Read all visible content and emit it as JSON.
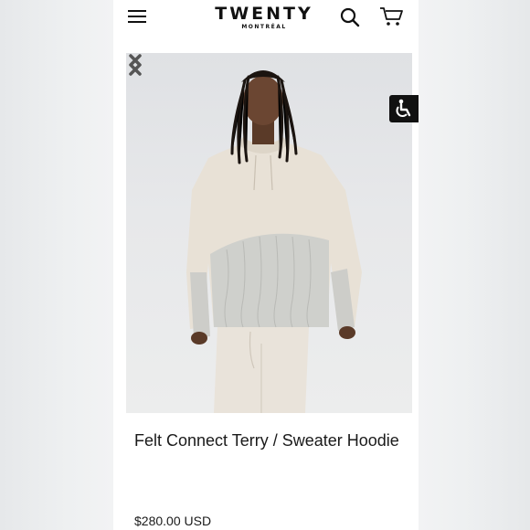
{
  "header": {
    "menu_icon": "hamburger-menu-icon",
    "brand_name": "TWENTY",
    "brand_city": "MONTRÉAL",
    "search_icon": "search-icon",
    "cart_icon": "cart-icon"
  },
  "gallery": {
    "image_subject": "man wearing cream terry hoodie with grey cable-knit sweater panel",
    "prev_icon": "chevron-left-icon",
    "next_icon": "chevron-right-icon"
  },
  "accessibility": {
    "icon": "accessibility-icon"
  },
  "product": {
    "title": "Felt Connect Terry / Sweater Hoodie",
    "price": "$280.00 USD"
  },
  "colors": {
    "text": "#1a1a1a",
    "background": "#ffffff",
    "arrow": "#555555",
    "hoodie": "#e7e0d5",
    "knit": "#cfd0cc"
  }
}
